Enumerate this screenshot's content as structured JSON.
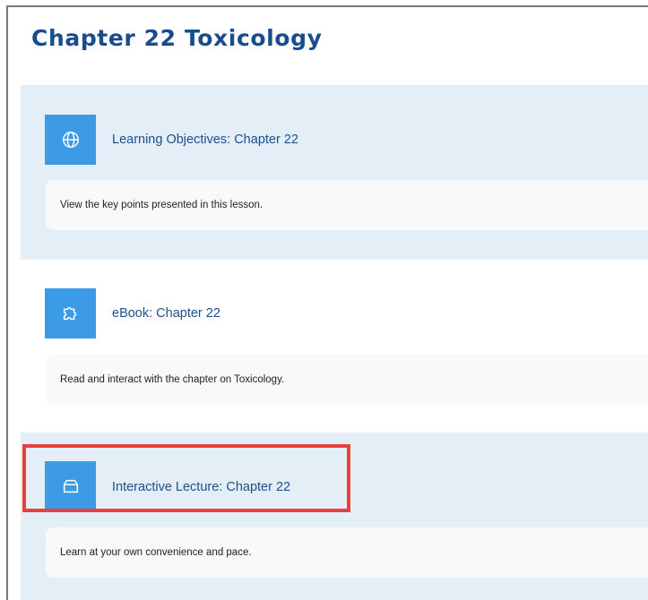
{
  "page": {
    "title": "Chapter 22 Toxicology"
  },
  "activities": [
    {
      "icon": "globe-icon",
      "link": "Learning Objectives: Chapter 22",
      "description": "View the key points presented in this lesson."
    },
    {
      "icon": "puzzle-icon",
      "link": "eBook: Chapter 22",
      "description": "Read and interact with the chapter on Toxicology."
    },
    {
      "icon": "box-icon",
      "link": "Interactive Lecture: Chapter 22",
      "description": "Learn at your own convenience and pace."
    }
  ],
  "colors": {
    "title": "#184c8c",
    "link": "#1f4f8c",
    "icon_tile": "#3d9be5",
    "section_tint": "#e3eef6",
    "description_bg": "#f7f9fb",
    "highlight": "#e8403a"
  }
}
